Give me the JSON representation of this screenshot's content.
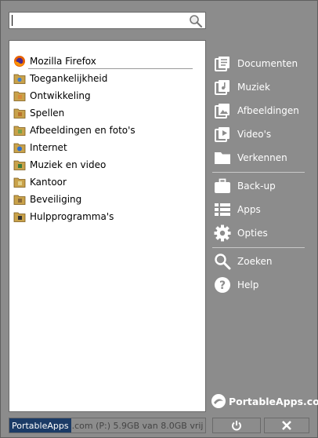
{
  "search": {
    "placeholder": ""
  },
  "apps": [
    {
      "label": "Mozilla Firefox",
      "icon": "firefox-icon"
    },
    {
      "label": "Toegankelijkheid",
      "icon": "folder-icon"
    },
    {
      "label": "Ontwikkeling",
      "icon": "folder-icon"
    },
    {
      "label": "Spellen",
      "icon": "folder-icon"
    },
    {
      "label": "Afbeeldingen en foto's",
      "icon": "folder-icon"
    },
    {
      "label": "Internet",
      "icon": "folder-icon"
    },
    {
      "label": "Muziek en video",
      "icon": "folder-icon"
    },
    {
      "label": "Kantoor",
      "icon": "folder-icon"
    },
    {
      "label": "Beveiliging",
      "icon": "folder-icon"
    },
    {
      "label": "Hulpprogramma's",
      "icon": "folder-icon"
    }
  ],
  "menu": {
    "documents": "Documenten",
    "music": "Muziek",
    "pictures": "Afbeeldingen",
    "videos": "Video's",
    "explore": "Verkennen",
    "backup": "Back-up",
    "apps": "Apps",
    "options": "Opties",
    "search": "Zoeken",
    "help": "Help"
  },
  "brand": "PortableApps.com",
  "status": {
    "app": "PortableApps",
    "info": ".com (P:) 5.9GB van 8.0GB vrij"
  },
  "colors": {
    "background": "#8c8c8c",
    "list_bg": "#ffffff",
    "status_highlight": "#1b3b66"
  }
}
